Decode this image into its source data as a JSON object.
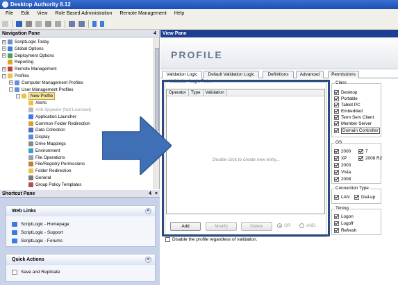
{
  "window": {
    "title": "Desktop Authority 8.12"
  },
  "menu": [
    "File",
    "Edit",
    "View",
    "Role Based Administration",
    "Remote Management",
    "Help"
  ],
  "toolbar": {
    "icons": [
      "new-icon",
      "save-icon",
      "open-icon",
      "copy-icon",
      "cut-icon",
      "paste-icon",
      "undo-icon",
      "redo-icon",
      "up-icon",
      "down-icon"
    ]
  },
  "nav": {
    "title": "Navigation Pane",
    "pin": "4",
    "tree": [
      {
        "label": "ScriptLogic Today",
        "expander": "+",
        "icon": "page-icon",
        "level": 0
      },
      {
        "label": "Global Options",
        "expander": "+",
        "icon": "globe-icon",
        "level": 0
      },
      {
        "label": "Deployment Options",
        "expander": "+",
        "icon": "deploy-icon",
        "level": 0
      },
      {
        "label": "Reporting",
        "expander": "",
        "icon": "report-icon",
        "level": 0
      },
      {
        "label": "Remote Management",
        "expander": "+",
        "icon": "remote-icon",
        "level": 0
      },
      {
        "label": "Profiles",
        "expander": "-",
        "icon": "folder-icon",
        "level": 0
      },
      {
        "label": "Computer Management Profiles",
        "expander": "+",
        "icon": "computer-icon",
        "level": 1
      },
      {
        "label": "User Management Profiles",
        "expander": "-",
        "icon": "users-icon",
        "level": 1
      },
      {
        "label": "New Profile",
        "expander": "-",
        "icon": "folder-icon",
        "level": 2,
        "selected": true
      },
      {
        "label": "Alerts",
        "expander": "",
        "icon": "alert-icon",
        "level": 3
      },
      {
        "label": "Anti-Spyware (Not Licensed)",
        "expander": "",
        "icon": "shield-icon",
        "level": 3,
        "disabled": true
      },
      {
        "label": "Application Launcher",
        "expander": "",
        "icon": "launcher-icon",
        "level": 3
      },
      {
        "label": "Common Folder Redirection",
        "expander": "",
        "icon": "redirect-icon",
        "level": 3
      },
      {
        "label": "Data Collection",
        "expander": "",
        "icon": "data-icon",
        "level": 3
      },
      {
        "label": "Display",
        "expander": "",
        "icon": "display-icon",
        "level": 3
      },
      {
        "label": "Drive Mappings",
        "expander": "",
        "icon": "drive-icon",
        "level": 3
      },
      {
        "label": "Environment",
        "expander": "",
        "icon": "environment-icon",
        "level": 3
      },
      {
        "label": "File Operations",
        "expander": "",
        "icon": "file-icon",
        "level": 3
      },
      {
        "label": "File/Registry Permissions",
        "expander": "",
        "icon": "permissions-icon",
        "level": 3
      },
      {
        "label": "Folder Redirection",
        "expander": "",
        "icon": "folder-icon",
        "level": 3
      },
      {
        "label": "General",
        "expander": "",
        "icon": "general-icon",
        "level": 3
      },
      {
        "label": "Group Policy Templates",
        "expander": "",
        "icon": "policy-icon",
        "level": 3
      }
    ]
  },
  "shortcut": {
    "title": "Shortcut Pane",
    "pin": "4",
    "weblinks": {
      "title": "Web Links",
      "items": [
        "ScriptLogic - Homepage",
        "ScriptLogic - Support",
        "ScriptLogic - Forums"
      ]
    },
    "quickactions": {
      "title": "Quick Actions",
      "items": [
        "Save and Replicate"
      ]
    },
    "collapse": "«"
  },
  "view": {
    "title": "View Pane",
    "header": "PROFILE",
    "tabs": [
      "Validation Logic",
      "Default Validation Logic",
      "Definitions",
      "Advanced",
      "Permissions"
    ],
    "active_tab": 0,
    "rules_group": "Validation Logic Rules",
    "columns": [
      "Operator",
      "Type",
      "Validation"
    ],
    "empty_text": "Double click to create new entry...",
    "buttons": {
      "add": "Add",
      "modify": "Modify",
      "delete": "Delete"
    },
    "radios": {
      "or": "OR",
      "and": "AND"
    },
    "disable_label": "Disable the profile regardless of validation.",
    "class": {
      "title": "Class",
      "items": [
        "Desktop",
        "Portable",
        "Tablet PC",
        "Embedded",
        "Term Serv Client",
        "Member Server",
        "Domain Controller"
      ]
    },
    "os": {
      "title": "OS",
      "items": [
        "2000",
        "7",
        "XP",
        "2008 R2",
        "2003",
        "Vista",
        "2008"
      ]
    },
    "connection": {
      "title": "Connection Type",
      "items": [
        "LAN",
        "Dial-up"
      ]
    },
    "timing": {
      "title": "Timing",
      "items": [
        "Logon",
        "Logoff",
        "Refresh"
      ]
    }
  },
  "colors": {
    "accent": "#1c3f94",
    "arrow": "#3f6fb5",
    "highlight": "#2c4a7e"
  }
}
